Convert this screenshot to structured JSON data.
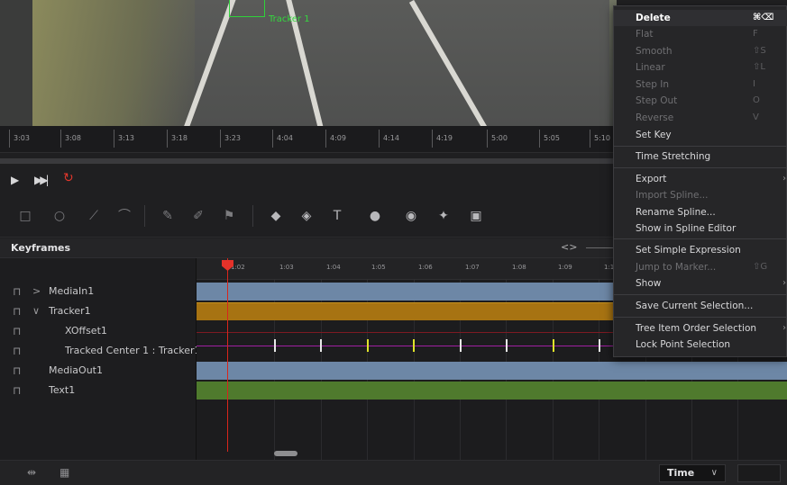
{
  "viewer": {
    "tracker_label": "Tracker 1"
  },
  "ruler": {
    "ticks": [
      "3:03",
      "3:08",
      "3:13",
      "3:18",
      "3:23",
      "4:04",
      "4:09",
      "4:14",
      "4:19",
      "5:00",
      "5:05",
      "5:10"
    ]
  },
  "transport": {
    "play_icon": "play-icon",
    "skip_icon": "skip-to-end-icon",
    "loop_icon": "loop-icon"
  },
  "keyframes": {
    "title": "Keyframes",
    "nav_arrows": "<>",
    "timeline_ticks": [
      "1:02",
      "1:03",
      "1:04",
      "1:05",
      "1:06",
      "1:07",
      "1:08",
      "1:09",
      "1:1"
    ]
  },
  "tree": {
    "items": [
      {
        "label": "MediaIn1",
        "caret": ">"
      },
      {
        "label": "Tracker1",
        "caret": "∨"
      },
      {
        "label": "XOffset1"
      },
      {
        "label": "Tracked Center 1 : Tracker1"
      },
      {
        "label": "MediaOut1"
      },
      {
        "label": "Text1"
      }
    ]
  },
  "bottom": {
    "time_select": "Time",
    "time_chevron": "∨"
  },
  "menu": {
    "items": [
      {
        "label": "Delete",
        "shortcut": "⌘⌫"
      },
      {
        "label": "Flat",
        "shortcut": "F"
      },
      {
        "label": "Smooth",
        "shortcut": "⇧S"
      },
      {
        "label": "Linear",
        "shortcut": "⇧L"
      },
      {
        "label": "Step In",
        "shortcut": "I"
      },
      {
        "label": "Step Out",
        "shortcut": "O"
      },
      {
        "label": "Reverse",
        "shortcut": "V"
      },
      {
        "label": "Set Key",
        "shortcut": ""
      },
      {
        "label": "Time Stretching",
        "shortcut": ""
      },
      {
        "label": "Export",
        "shortcut": ""
      },
      {
        "label": "Import Spline...",
        "shortcut": ""
      },
      {
        "label": "Rename Spline...",
        "shortcut": ""
      },
      {
        "label": "Show in Spline Editor",
        "shortcut": ""
      },
      {
        "label": "Set Simple Expression",
        "shortcut": ""
      },
      {
        "label": "Jump to Marker...",
        "shortcut": "⇧G"
      },
      {
        "label": "Show",
        "shortcut": ""
      },
      {
        "label": "Save Current Selection...",
        "shortcut": ""
      },
      {
        "label": "Tree Item Order Selection",
        "shortcut": ""
      },
      {
        "label": "Lock Point Selection",
        "shortcut": ""
      }
    ]
  },
  "colors": {
    "media_bar": "#6d87a6",
    "tracker_bar": "#a77312",
    "text_bar": "#4f7a2d",
    "playhead": "#e5322a",
    "tracker_green": "#35d83f",
    "loop_red": "#e0362b"
  }
}
